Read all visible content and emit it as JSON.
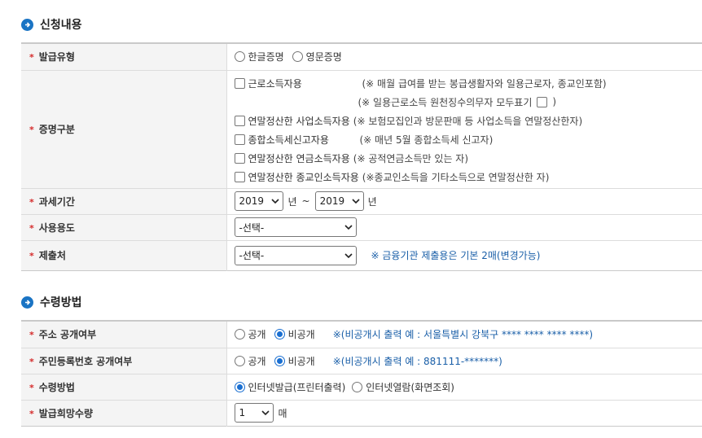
{
  "section1": {
    "title": "신청내용",
    "rows": {
      "issue_type": {
        "label": "발급유형",
        "options": [
          "한글증명",
          "영문증명"
        ]
      },
      "cert_type": {
        "label": "증명구분",
        "items": [
          {
            "label": "근로소득자용",
            "note": "(※ 매월 급여를 받는 봉급생활자와 일용근로자, 종교인포함)"
          },
          {
            "sub_note": "(※ 일용근로소득 원천징수의무자 모두표기",
            "sub_close": ")"
          },
          {
            "label": "연말정산한 사업소득자용",
            "note": "(※ 보험모집인과 방문판매 등 사업소득을 연말정산한자)"
          },
          {
            "label": "종합소득세신고자용",
            "note": "(※ 매년 5월 종합소득세 신고자)"
          },
          {
            "label": "연말정산한 연금소득자용",
            "note": "(※ 공적연금소득만 있는 자)"
          },
          {
            "label": "연말정산한 종교인소득자용",
            "note": "(※종교인소득을 기타소득으로 연말정산한 자)"
          }
        ]
      },
      "tax_period": {
        "label": "과세기간",
        "from_year": "2019",
        "to_year": "2019",
        "year_unit": "년",
        "tilde": "~"
      },
      "usage": {
        "label": "사용용도",
        "selected": "-선택-"
      },
      "submit_to": {
        "label": "제출처",
        "selected": "-선택-",
        "note": "※ 금융기관 제출용은 기본 2매(변경가능)"
      }
    }
  },
  "section2": {
    "title": "수령방법",
    "rows": {
      "address_public": {
        "label": "주소 공개여부",
        "options": [
          "공개",
          "비공개"
        ],
        "selected": "비공개",
        "note": "※(비공개시 출력 예 : 서울특별시 강북구 **** **** **** ****)"
      },
      "rrn_public": {
        "label": "주민등록번호 공개여부",
        "options": [
          "공개",
          "비공개"
        ],
        "selected": "비공개",
        "note": "※(비공개시 출력 예 : 881111-*******)"
      },
      "receive_method": {
        "label": "수령방법",
        "options": [
          "인터넷발급(프린터출력)",
          "인터넷열람(화면조회)"
        ],
        "selected": "인터넷발급(프린터출력)"
      },
      "quantity": {
        "label": "발급희망수량",
        "selected": "1",
        "unit": "매"
      }
    }
  },
  "required_mark": "*",
  "colors": {
    "accent": "#1a74c4",
    "note_blue": "#1a5fa8",
    "required": "#d52b2b"
  }
}
